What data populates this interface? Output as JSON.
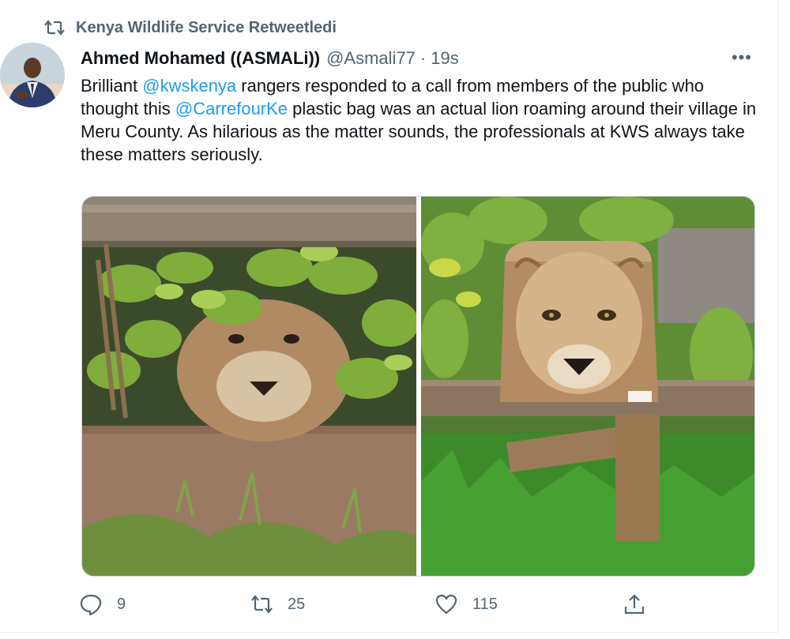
{
  "retweet": {
    "label": "Kenya Wildlife Service Retweetledi",
    "icon": "retweet-icon"
  },
  "tweet": {
    "author_name": "Ahmed Mohamed ((ASMALi))",
    "author_handle": "@Asmali77",
    "separator": "·",
    "time": "19s",
    "more_label": "•••",
    "text": {
      "part1": "Brilliant ",
      "mention1": "@kwskenya",
      "part2": " rangers responded to a call from members of the public who thought this ",
      "mention2": "@CarrefourKe",
      "part3": " plastic bag was an actual lion roaming around their village in Meru County. As hilarious as the matter sounds, the professionals at KWS always take these matters seriously."
    },
    "media": [
      {
        "description_icon": "lion-under-bench-photo"
      },
      {
        "description_icon": "lion-print-bag-photo"
      }
    ]
  },
  "actions": {
    "replies": "9",
    "retweets": "25",
    "likes": "115"
  },
  "colors": {
    "accent": "#1d9bf0",
    "muted": "#536471",
    "text": "#0f1419"
  }
}
